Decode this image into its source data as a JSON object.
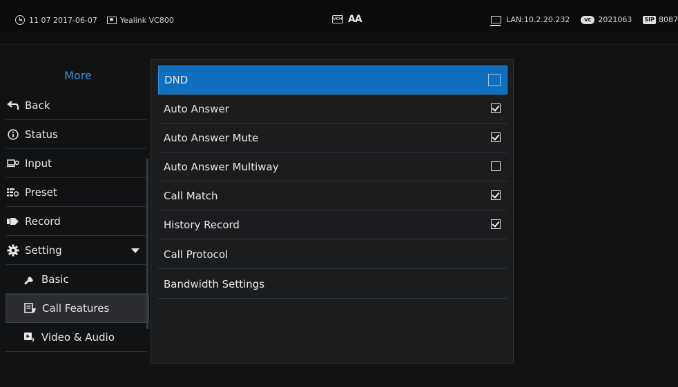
{
  "status_bar": {
    "time_date": "11 07 2017-06-07",
    "device_name": "Yealink VC800",
    "vc_icon_text": "VCH",
    "font_icon_text": "AA",
    "lan_ip": "LAN:10.2.20.232",
    "cloud_icon_text": "VC",
    "cloud_account": "2021063",
    "sip_badge": "SIP",
    "sip_account": "8087"
  },
  "sidebar": {
    "title": "More",
    "items": [
      {
        "label": "Back",
        "icon": "back-arrow-icon"
      },
      {
        "label": "Status",
        "icon": "info-icon"
      },
      {
        "label": "Input",
        "icon": "input-icon"
      },
      {
        "label": "Preset",
        "icon": "preset-icon"
      },
      {
        "label": "Record",
        "icon": "record-icon"
      },
      {
        "label": "Setting",
        "icon": "gear-icon"
      },
      {
        "label": "Basic",
        "icon": "wrench-icon"
      },
      {
        "label": "Call Features",
        "icon": "call-features-icon"
      },
      {
        "label": "Video & Audio",
        "icon": "video-audio-icon"
      }
    ]
  },
  "panel": {
    "rows": [
      {
        "label": "DND",
        "checkbox": true,
        "checked": false,
        "selected": true
      },
      {
        "label": "Auto Answer",
        "checkbox": true,
        "checked": true
      },
      {
        "label": "Auto Answer Mute",
        "checkbox": true,
        "checked": true
      },
      {
        "label": "Auto Answer Multiway",
        "checkbox": true,
        "checked": false
      },
      {
        "label": "Call Match",
        "checkbox": true,
        "checked": true
      },
      {
        "label": "History Record",
        "checkbox": true,
        "checked": true
      },
      {
        "label": "Call Protocol",
        "checkbox": false
      },
      {
        "label": "Bandwidth Settings",
        "checkbox": false
      }
    ]
  },
  "colors": {
    "accent": "#0f6fbe",
    "title": "#3d8fd1",
    "background": "#111213",
    "panel": "#1b1c1e"
  }
}
